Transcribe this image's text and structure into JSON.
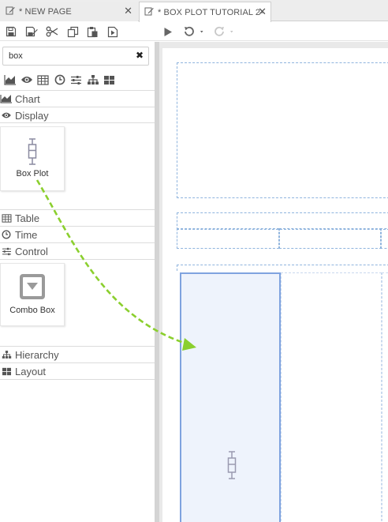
{
  "tabs": [
    {
      "label": "* NEW PAGE",
      "icon": "edit-icon",
      "active": false
    },
    {
      "label": "* BOX PLOT TUTORIAL 2-",
      "icon": "edit-icon",
      "active": true
    }
  ],
  "tab_close_glyph": "✕",
  "toolbar": {
    "left_buttons": [
      "save-icon",
      "save-as-icon",
      "cut-icon",
      "copy-icon",
      "paste-icon",
      "preview-icon"
    ],
    "run_button": "play-icon",
    "undo_button": "undo-icon",
    "redo_button": "redo-icon"
  },
  "search": {
    "value": "box",
    "clear_glyph": "✖"
  },
  "category_icons": [
    "area-chart-icon",
    "eye-icon",
    "table-icon",
    "clock-icon",
    "sliders-icon",
    "hierarchy-icon",
    "layout-grid-icon"
  ],
  "sections": {
    "chart": "Chart",
    "display": "Display",
    "table": "Table",
    "time": "Time",
    "control": "Control",
    "hierarchy": "Hierarchy",
    "layout": "Layout"
  },
  "widgets": {
    "box_plot": "Box Plot",
    "combo_box": "Combo Box"
  },
  "colors": {
    "accent_drag_arrow": "#8bcf2e",
    "drop_fill": "#eef3fc",
    "drop_border": "#7fa3df",
    "dashed_guides": "#8fb4de"
  }
}
